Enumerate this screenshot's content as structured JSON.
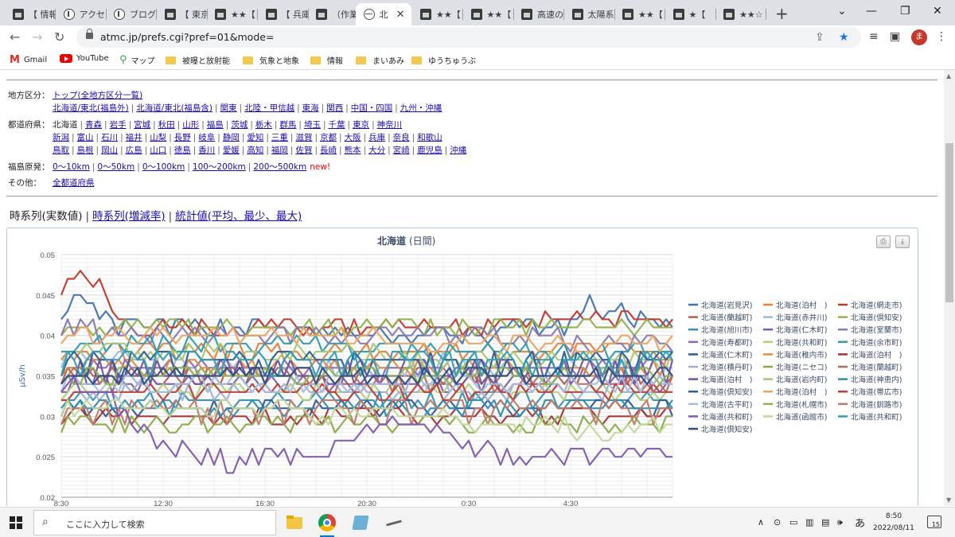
{
  "browser": {
    "tabs": [
      {
        "title": "【 情報",
        "icon": "site-icon"
      },
      {
        "title": "アクセ",
        "icon": "info-icon"
      },
      {
        "title": "ブログ",
        "icon": "info-icon"
      },
      {
        "title": "【 東京",
        "icon": "site-icon"
      },
      {
        "title": "★★【",
        "icon": "site-icon"
      },
      {
        "title": "【 兵庫",
        "icon": "site-icon"
      },
      {
        "title": "（作業",
        "icon": "site-icon"
      },
      {
        "title": "北",
        "icon": "globe-icon",
        "active": true
      },
      {
        "title": "★★【",
        "icon": "site-icon"
      },
      {
        "title": "★★【",
        "icon": "site-icon"
      },
      {
        "title": "高速の",
        "icon": "site-icon"
      },
      {
        "title": "太陽系",
        "icon": "site-icon"
      },
      {
        "title": "★★【",
        "icon": "site-icon"
      },
      {
        "title": "★【",
        "icon": "site-icon"
      },
      {
        "title": "★★☆",
        "icon": "site-icon"
      }
    ],
    "url": "atmc.jp/prefs.cgi?pref=01&mode=",
    "profile_initial": "ま",
    "bookmarks": [
      {
        "label": "Gmail",
        "icon": "gmail-icon"
      },
      {
        "label": "YouTube",
        "icon": "youtube-icon"
      },
      {
        "label": "マップ",
        "icon": "maps-icon"
      },
      {
        "label": "被曝と放射能",
        "icon": "folder-icon"
      },
      {
        "label": "気象と地象",
        "icon": "folder-icon"
      },
      {
        "label": "情報",
        "icon": "folder-icon"
      },
      {
        "label": "まいあみ",
        "icon": "folder-icon"
      },
      {
        "label": "ゆうちゅうぶ",
        "icon": "folder-icon"
      }
    ]
  },
  "nav": {
    "region_label": "地方区分：",
    "region_top": "トップ(全地方区分一覧)",
    "regions": [
      "北海道/東北(福島外)",
      "北海道/東北(福島含)",
      "関東",
      "北陸・甲信越",
      "東海",
      "関西",
      "中国・四国",
      "九州・沖縄"
    ],
    "pref_label": "都道府県：",
    "pref_current": "北海道",
    "pref_row1": [
      "青森",
      "岩手",
      "宮城",
      "秋田",
      "山形",
      "福島",
      "茨城",
      "栃木",
      "群馬",
      "埼玉",
      "千葉",
      "東京",
      "神奈川"
    ],
    "pref_row2": [
      "新潟",
      "富山",
      "石川",
      "福井",
      "山梨",
      "長野",
      "岐阜",
      "静岡",
      "愛知",
      "三重",
      "滋賀",
      "京都",
      "大阪",
      "兵庫",
      "奈良",
      "和歌山"
    ],
    "pref_row3": [
      "鳥取",
      "島根",
      "岡山",
      "広島",
      "山口",
      "徳島",
      "香川",
      "愛媛",
      "高知",
      "福岡",
      "佐賀",
      "長崎",
      "熊本",
      "大分",
      "宮崎",
      "鹿児島",
      "沖縄"
    ],
    "fukushima_label": "福島原発：",
    "fukushima": [
      "0〜10km",
      "0〜50km",
      "0〜100km",
      "100〜200km",
      "200〜500km"
    ],
    "new_label": "new!",
    "other_label": "その他：",
    "other": "全都道府県"
  },
  "views": {
    "current": "時系列(実数値)",
    "link1": "時系列(増減率)",
    "link2": "統計値(平均、最少、最大)"
  },
  "chart_data": {
    "type": "line",
    "title": "北海道",
    "subtitle": "(日間)",
    "ylabel": "μSv/h",
    "ylim": [
      0.02,
      0.05
    ],
    "yticks": [
      "0.02",
      "0.025",
      "0.03",
      "0.035",
      "0.04",
      "0.045",
      "0.05"
    ],
    "xticks": [
      "8:30",
      "12:30",
      "16:30",
      "20:30",
      "0:30",
      "4:30"
    ],
    "grid": true,
    "legend_position": "right",
    "n_points": 97,
    "series": [
      {
        "name": "北海道(岩見沢)",
        "color": "#3f74b0",
        "values": [
          [
            0,
            0.043
          ],
          [
            3,
            0.044
          ],
          [
            6,
            0.042
          ],
          [
            9,
            0.041
          ],
          [
            15,
            0.0405
          ],
          [
            35,
            0.0405
          ],
          [
            60,
            0.04
          ],
          [
            80,
            0.041
          ],
          [
            82,
            0.0435
          ],
          [
            86,
            0.0435
          ],
          [
            90,
            0.042
          ],
          [
            96,
            0.041
          ]
        ]
      },
      {
        "name": "北海道(泊村　)",
        "color": "#e8803a",
        "values": [
          [
            0,
            0.038
          ],
          [
            30,
            0.038
          ],
          [
            50,
            0.0375
          ],
          [
            70,
            0.038
          ],
          [
            96,
            0.0375
          ]
        ]
      },
      {
        "name": "北海道(網走市)",
        "color": "#c0392b",
        "values": [
          [
            0,
            0.046
          ],
          [
            1,
            0.047
          ],
          [
            3,
            0.047
          ],
          [
            5,
            0.046
          ],
          [
            7,
            0.045
          ],
          [
            9,
            0.042
          ],
          [
            12,
            0.041
          ],
          [
            20,
            0.041
          ],
          [
            40,
            0.0405
          ],
          [
            60,
            0.041
          ],
          [
            76,
            0.042
          ],
          [
            86,
            0.042
          ],
          [
            96,
            0.0415
          ]
        ]
      },
      {
        "name": "北海道(蘭越町)",
        "color": "#b25d4f",
        "values": [
          [
            0,
            0.035
          ],
          [
            40,
            0.035
          ],
          [
            70,
            0.0345
          ],
          [
            96,
            0.035
          ]
        ]
      },
      {
        "name": "北海道(赤井川)",
        "color": "#9db8dc",
        "values": [
          [
            0,
            0.037
          ],
          [
            30,
            0.036
          ],
          [
            60,
            0.0365
          ],
          [
            96,
            0.036
          ]
        ]
      },
      {
        "name": "北海道(倶知安)",
        "color": "#8fb24a",
        "values": [
          [
            0,
            0.041
          ],
          [
            25,
            0.041
          ],
          [
            55,
            0.041
          ],
          [
            75,
            0.0405
          ],
          [
            96,
            0.041
          ]
        ]
      },
      {
        "name": "北海道(旭川市)",
        "color": "#3a8fb6",
        "values": [
          [
            0,
            0.032
          ],
          [
            50,
            0.032
          ],
          [
            96,
            0.032
          ]
        ]
      },
      {
        "name": "北海道(仁木町)",
        "color": "#7b5ea7",
        "values": [
          [
            0,
            0.034
          ],
          [
            40,
            0.034
          ],
          [
            96,
            0.0345
          ]
        ]
      },
      {
        "name": "北海道(室蘭市)",
        "color": "#8a78b0",
        "values": [
          [
            0,
            0.041
          ],
          [
            10,
            0.04
          ],
          [
            50,
            0.04
          ],
          [
            70,
            0.04
          ],
          [
            96,
            0.0385
          ]
        ]
      },
      {
        "name": "北海道(寿都町)",
        "color": "#8b6bb5",
        "values": [
          [
            0,
            0.036
          ],
          [
            50,
            0.0355
          ],
          [
            96,
            0.036
          ]
        ]
      },
      {
        "name": "北海道(共和町)",
        "color": "#b3cf78",
        "values": [
          [
            0,
            0.033
          ],
          [
            20,
            0.0325
          ],
          [
            60,
            0.033
          ],
          [
            96,
            0.0335
          ]
        ]
      },
      {
        "name": "北海道(余市町)",
        "color": "#2d9bb1",
        "values": [
          [
            0,
            0.0385
          ],
          [
            30,
            0.039
          ],
          [
            60,
            0.038
          ],
          [
            96,
            0.0385
          ]
        ]
      },
      {
        "name": "北海道(仁木町)",
        "color": "#2b5c9c",
        "values": [
          [
            0,
            0.031
          ],
          [
            50,
            0.031
          ],
          [
            96,
            0.031
          ]
        ]
      },
      {
        "name": "北海道(稚内市)",
        "color": "#e38a3d",
        "values": [
          [
            0,
            0.036
          ],
          [
            40,
            0.036
          ],
          [
            96,
            0.036
          ]
        ]
      },
      {
        "name": "北海道(泊村　)",
        "color": "#a83232",
        "values": [
          [
            0,
            0.03
          ],
          [
            40,
            0.03
          ],
          [
            96,
            0.03
          ]
        ]
      },
      {
        "name": "北海道(積丹町)",
        "color": "#9fb0d8",
        "values": [
          [
            0,
            0.033
          ],
          [
            40,
            0.033
          ],
          [
            96,
            0.033
          ]
        ]
      },
      {
        "name": "北海道(ニセコ)",
        "color": "#8bab47",
        "values": [
          [
            0,
            0.029
          ],
          [
            40,
            0.029
          ],
          [
            96,
            0.0285
          ]
        ]
      },
      {
        "name": "北海道(蘭越町)",
        "color": "#b8695a",
        "values": [
          [
            0,
            0.0345
          ],
          [
            40,
            0.0345
          ],
          [
            96,
            0.034
          ]
        ]
      },
      {
        "name": "北海道(泊村　)",
        "color": "#6e55a0",
        "values": [
          [
            0,
            0.0355
          ],
          [
            50,
            0.0355
          ],
          [
            96,
            0.0355
          ]
        ]
      },
      {
        "name": "北海道(岩内町)",
        "color": "#a9c773",
        "values": [
          [
            0,
            0.0375
          ],
          [
            50,
            0.0375
          ],
          [
            96,
            0.037
          ]
        ]
      },
      {
        "name": "北海道(神恵内)",
        "color": "#2e8fb0",
        "values": [
          [
            0,
            0.031
          ],
          [
            50,
            0.0315
          ],
          [
            96,
            0.031
          ]
        ]
      },
      {
        "name": "北海道(倶知安)",
        "color": "#2e5d9b",
        "values": [
          [
            0,
            0.0365
          ],
          [
            50,
            0.0365
          ],
          [
            96,
            0.0365
          ]
        ]
      },
      {
        "name": "北海道(泊村　)",
        "color": "#f0a25c",
        "values": [
          [
            0,
            0.0395
          ],
          [
            50,
            0.0395
          ],
          [
            96,
            0.039
          ]
        ]
      },
      {
        "name": "北海道(帯広市)",
        "color": "#bf3f36",
        "values": [
          [
            0,
            0.0325
          ],
          [
            50,
            0.0325
          ],
          [
            96,
            0.0325
          ]
        ]
      },
      {
        "name": "北海道(古平町)",
        "color": "#a5bde0",
        "values": [
          [
            0,
            0.0335
          ],
          [
            50,
            0.0335
          ],
          [
            96,
            0.0335
          ]
        ]
      },
      {
        "name": "北海道(札幌市)",
        "color": "#8db553",
        "values": [
          [
            0,
            0.0345
          ],
          [
            50,
            0.0345
          ],
          [
            96,
            0.0345
          ]
        ]
      },
      {
        "name": "北海道(釧路市)",
        "color": "#c07a6a",
        "values": [
          [
            0,
            0.0305
          ],
          [
            50,
            0.0305
          ],
          [
            96,
            0.0305
          ]
        ]
      },
      {
        "name": "北海道(共和町)",
        "color": "#7e5ab0",
        "values": [
          [
            0,
            0.034
          ],
          [
            3,
            0.0335
          ],
          [
            10,
            0.031
          ],
          [
            14,
            0.0275
          ],
          [
            18,
            0.026
          ],
          [
            20,
            0.025
          ],
          [
            24,
            0.025
          ],
          [
            27,
            0.024
          ],
          [
            30,
            0.0245
          ],
          [
            35,
            0.025
          ],
          [
            40,
            0.0255
          ],
          [
            44,
            0.026
          ],
          [
            47,
            0.0275
          ],
          [
            50,
            0.0285
          ],
          [
            60,
            0.0285
          ],
          [
            62,
            0.026
          ],
          [
            66,
            0.026
          ],
          [
            70,
            0.025
          ],
          [
            80,
            0.025
          ],
          [
            84,
            0.0245
          ],
          [
            88,
            0.025
          ],
          [
            92,
            0.025
          ],
          [
            96,
            0.025
          ]
        ]
      },
      {
        "name": "北海道(函館市)",
        "color": "#c2d89a",
        "values": [
          [
            0,
            0.031
          ],
          [
            30,
            0.031
          ],
          [
            60,
            0.0295
          ],
          [
            90,
            0.028
          ],
          [
            96,
            0.029
          ]
        ]
      },
      {
        "name": "北海道(共和町)",
        "color": "#2f9fb6",
        "values": [
          [
            0,
            0.0365
          ],
          [
            50,
            0.0365
          ],
          [
            96,
            0.0365
          ]
        ]
      },
      {
        "name": "北海道(倶知安)",
        "color": "#2d4f85",
        "values": [
          [
            0,
            0.035
          ],
          [
            50,
            0.035
          ],
          [
            96,
            0.035
          ]
        ]
      }
    ]
  },
  "taskbar": {
    "search_placeholder": "ここに入力して検索",
    "ime": "あ",
    "time": "8:50",
    "date": "2022/08/11",
    "notifications": "15"
  }
}
